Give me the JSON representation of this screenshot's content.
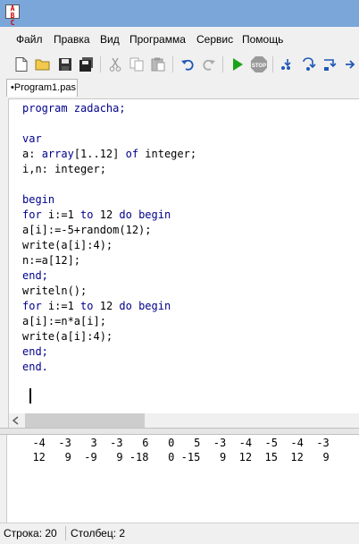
{
  "app_icon": {
    "top": "A B",
    "bottom": "C"
  },
  "menu": [
    "Файл",
    "Правка",
    "Вид",
    "Программа",
    "Сервис",
    "Помощь"
  ],
  "toolbar": {
    "icons": [
      "new-file-icon",
      "open-folder-icon",
      "save-icon",
      "save-all-icon",
      "cut-icon",
      "copy-icon",
      "paste-icon",
      "undo-icon",
      "redo-icon",
      "run-icon",
      "stop-icon",
      "step-into-icon",
      "step-over-icon",
      "step-out-icon",
      "next-icon"
    ],
    "stop_label": "STOP",
    "colors": {
      "run": "#1aa31a",
      "stop": "#9a9a9a"
    }
  },
  "tab": {
    "label": "•Program1.pas"
  },
  "editor": {
    "lines": [
      [
        [
          "program zadacha;",
          "kw"
        ]
      ],
      [],
      [
        [
          "var",
          "kw"
        ]
      ],
      [
        [
          "a: ",
          ""
        ],
        [
          "array",
          "kw"
        ],
        [
          "[1..12] ",
          ""
        ],
        [
          "of",
          "kw"
        ],
        [
          " integer;",
          ""
        ]
      ],
      [
        [
          "i,n: integer;",
          ""
        ]
      ],
      [],
      [
        [
          "begin",
          "kw"
        ]
      ],
      [
        [
          "for",
          "kw"
        ],
        [
          " i:=1 ",
          ""
        ],
        [
          "to",
          "kw"
        ],
        [
          " 12 ",
          ""
        ],
        [
          "do begin",
          "kw"
        ]
      ],
      [
        [
          "a[i]:=-5+random(12);",
          ""
        ]
      ],
      [
        [
          "write(a[i]:4);",
          ""
        ]
      ],
      [
        [
          "n:=a[12];",
          ""
        ]
      ],
      [
        [
          "end;",
          "kw"
        ]
      ],
      [
        [
          "writeln();",
          ""
        ]
      ],
      [
        [
          "for",
          "kw"
        ],
        [
          " i:=1 ",
          ""
        ],
        [
          "to",
          "kw"
        ],
        [
          " 12 ",
          ""
        ],
        [
          "do begin",
          "kw"
        ]
      ],
      [
        [
          "a[i]:=n*a[i];",
          ""
        ]
      ],
      [
        [
          "write(a[i]:4);",
          ""
        ]
      ],
      [
        [
          "end;",
          "kw"
        ]
      ],
      [
        [
          "end.",
          "kw"
        ]
      ]
    ],
    "keyword_color": "#00008b"
  },
  "output": {
    "lines": [
      "  -4  -3   3  -3   6   0   5  -3  -4  -5  -4  -3",
      "  12   9  -9   9 -18   0 -15   9  12  15  12   9"
    ]
  },
  "status": {
    "row": "Строка: 20",
    "col": "Столбец: 2"
  }
}
